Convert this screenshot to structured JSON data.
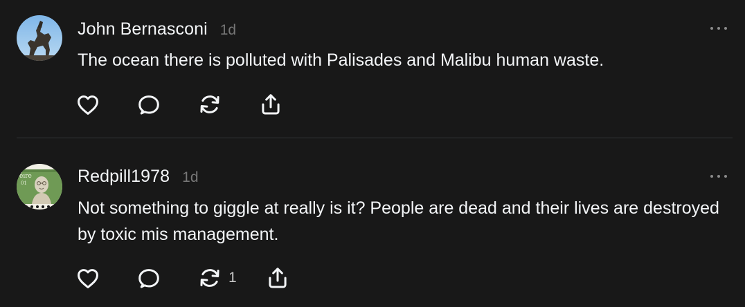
{
  "posts": [
    {
      "username": "John Bernasconi",
      "time": "1d",
      "text": "The ocean there is polluted with Palisades and Malibu human waste.",
      "avatar_icon": "statue-avatar",
      "actions": {
        "like_icon": "heart-icon",
        "reply_icon": "comment-icon",
        "repost_icon": "repost-icon",
        "repost_count": "",
        "share_icon": "share-icon"
      },
      "menu_icon": "more-icon"
    },
    {
      "username": "Redpill1978",
      "time": "1d",
      "text": "Not something to giggle at really is it? People are dead and their lives are destroyed by toxic mis management.",
      "avatar_icon": "stamp-avatar",
      "actions": {
        "like_icon": "heart-icon",
        "reply_icon": "comment-icon",
        "repost_icon": "repost-icon",
        "repost_count": "1",
        "share_icon": "share-icon"
      },
      "menu_icon": "more-icon"
    }
  ],
  "colors": {
    "background": "#181818",
    "primary_text": "#f3f5f7",
    "secondary_text": "#777777",
    "divider": "#333638"
  }
}
